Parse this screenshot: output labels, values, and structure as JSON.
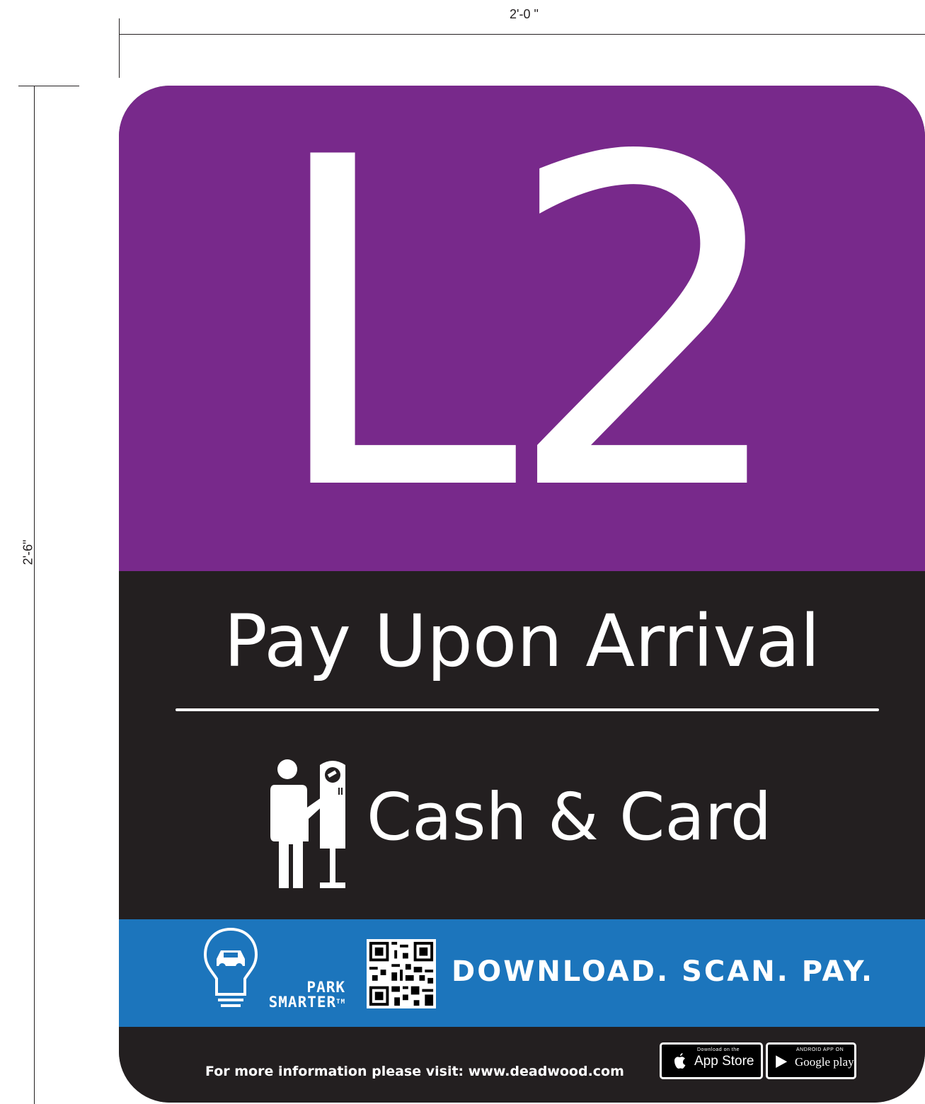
{
  "dimensions": {
    "width_label": "2'-0 \"",
    "height_label": "2'-6\""
  },
  "sign": {
    "level": "L2",
    "headline": "Pay Upon Arrival",
    "payment_methods": "Cash & Card",
    "app": {
      "brand_line1": "PARK",
      "brand_line2": "SMARTER",
      "trademark": "TM",
      "call_to_action": "DOWNLOAD. SCAN. PAY."
    },
    "footer": {
      "info_text": "For more information please visit:  www.deadwood.com",
      "apple_badge_small": "Download on the",
      "apple_badge_big": "App Store",
      "google_badge_small": "ANDROID APP ON",
      "google_badge_big": "Google play"
    }
  },
  "colors": {
    "level_panel": "#78298b",
    "dark_panel": "#231f20",
    "app_panel": "#1c75bc",
    "text": "#ffffff"
  },
  "icons": [
    "person-at-parking-meter-icon",
    "lightbulb-car-icon",
    "qr-code-icon",
    "apple-icon",
    "google-play-icon"
  ]
}
